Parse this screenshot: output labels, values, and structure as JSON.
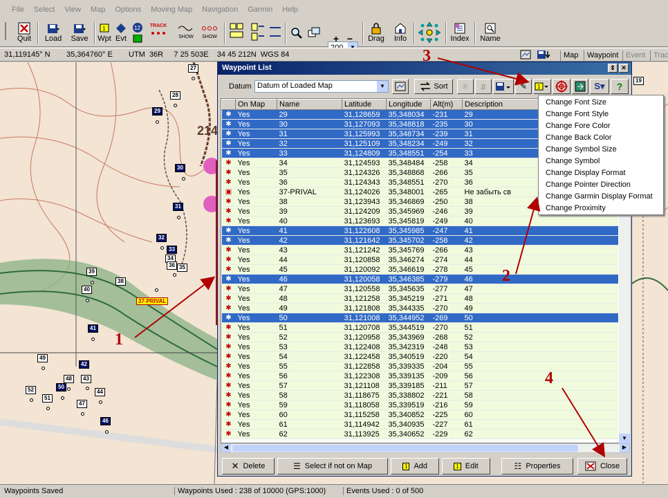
{
  "menubar": {
    "items": [
      "File",
      "Select",
      "View",
      "Map",
      "Options",
      "Moving Map",
      "Navigation",
      "Garmin",
      "Help"
    ]
  },
  "toolbar": {
    "quit": "Quit",
    "load": "Load",
    "save": "Save",
    "wpt": "Wpt",
    "evt": "Evt",
    "zoom_value": "200",
    "drag": "Drag",
    "info": "Info",
    "index": "Index",
    "name": "Name",
    "show1": "SHOW",
    "show2": "SHOW",
    "track": "TRACK"
  },
  "coords": {
    "lat": "31,119145° N",
    "lon": "35,364760° E",
    "utm": "UTM  36R     7 25 503E    34 45 212N  WGS 84",
    "tabs": [
      "Map",
      "Waypoint",
      "Event",
      "Trac"
    ]
  },
  "window": {
    "title": "Waypoint List",
    "datum_label": "Datum",
    "datum_value": "Datum of Loaded Map",
    "sort": "Sort"
  },
  "columns": [
    "On Map",
    "Name",
    "Latitude",
    "Longitude",
    "Alt(m)",
    "Description"
  ],
  "rows": [
    {
      "onmap": "Yes",
      "name": "29",
      "lat": "31,128659",
      "lon": "35,348034",
      "alt": "-231",
      "desc": "29",
      "sel": true
    },
    {
      "onmap": "Yes",
      "name": "30",
      "lat": "31,127093",
      "lon": "35,348818",
      "alt": "-235",
      "desc": "30",
      "sel": true
    },
    {
      "onmap": "Yes",
      "name": "31",
      "lat": "31,125993",
      "lon": "35,348734",
      "alt": "-239",
      "desc": "31",
      "sel": true
    },
    {
      "onmap": "Yes",
      "name": "32",
      "lat": "31,125109",
      "lon": "35,348234",
      "alt": "-249",
      "desc": "32",
      "sel": true
    },
    {
      "onmap": "Yes",
      "name": "33",
      "lat": "31,124809",
      "lon": "35,348551",
      "alt": "-254",
      "desc": "33",
      "sel": true
    },
    {
      "onmap": "Yes",
      "name": "34",
      "lat": "31,124593",
      "lon": "35,348484",
      "alt": "-258",
      "desc": "34",
      "sel": false
    },
    {
      "onmap": "Yes",
      "name": "35",
      "lat": "31,124326",
      "lon": "35,348868",
      "alt": "-266",
      "desc": "35",
      "sel": false
    },
    {
      "onmap": "Yes",
      "name": "36",
      "lat": "31,124343",
      "lon": "35,348551",
      "alt": "-270",
      "desc": "36",
      "sel": false
    },
    {
      "onmap": "Yes",
      "name": "37-PRIVAL",
      "lat": "31,124026",
      "lon": "35,348001",
      "alt": "-265",
      "desc": "Не забыть св",
      "sel": false
    },
    {
      "onmap": "Yes",
      "name": "38",
      "lat": "31,123943",
      "lon": "35,346869",
      "alt": "-250",
      "desc": "38",
      "sel": false
    },
    {
      "onmap": "Yes",
      "name": "39",
      "lat": "31,124209",
      "lon": "35,345969",
      "alt": "-246",
      "desc": "39",
      "sel": false
    },
    {
      "onmap": "Yes",
      "name": "40",
      "lat": "31,123693",
      "lon": "35,345819",
      "alt": "-249",
      "desc": "40",
      "sel": false
    },
    {
      "onmap": "Yes",
      "name": "41",
      "lat": "31,122608",
      "lon": "35,345985",
      "alt": "-247",
      "desc": "41",
      "sel": true
    },
    {
      "onmap": "Yes",
      "name": "42",
      "lat": "31,121642",
      "lon": "35,345702",
      "alt": "-258",
      "desc": "42",
      "sel": true
    },
    {
      "onmap": "Yes",
      "name": "43",
      "lat": "31,121242",
      "lon": "35,345769",
      "alt": "-266",
      "desc": "43",
      "sel": false
    },
    {
      "onmap": "Yes",
      "name": "44",
      "lat": "31,120858",
      "lon": "35,346274",
      "alt": "-274",
      "desc": "44",
      "sel": false
    },
    {
      "onmap": "Yes",
      "name": "45",
      "lat": "31,120092",
      "lon": "35,346619",
      "alt": "-278",
      "desc": "45",
      "sel": false
    },
    {
      "onmap": "Yes",
      "name": "46",
      "lat": "31,120058",
      "lon": "35,346385",
      "alt": "-279",
      "desc": "46",
      "sel": true
    },
    {
      "onmap": "Yes",
      "name": "47",
      "lat": "31,120558",
      "lon": "35,345635",
      "alt": "-277",
      "desc": "47",
      "sel": false
    },
    {
      "onmap": "Yes",
      "name": "48",
      "lat": "31,121258",
      "lon": "35,345219",
      "alt": "-271",
      "desc": "48",
      "sel": false
    },
    {
      "onmap": "Yes",
      "name": "49",
      "lat": "31,121808",
      "lon": "35,344335",
      "alt": "-270",
      "desc": "49",
      "sel": false
    },
    {
      "onmap": "Yes",
      "name": "50",
      "lat": "31,121008",
      "lon": "35,344952",
      "alt": "-269",
      "desc": "50",
      "sel": true
    },
    {
      "onmap": "Yes",
      "name": "51",
      "lat": "31,120708",
      "lon": "35,344519",
      "alt": "-270",
      "desc": "51",
      "sel": false
    },
    {
      "onmap": "Yes",
      "name": "52",
      "lat": "31,120958",
      "lon": "35,343969",
      "alt": "-268",
      "desc": "52",
      "sel": false
    },
    {
      "onmap": "Yes",
      "name": "53",
      "lat": "31,122408",
      "lon": "35,342319",
      "alt": "-248",
      "desc": "53",
      "sel": false
    },
    {
      "onmap": "Yes",
      "name": "54",
      "lat": "31,122458",
      "lon": "35,340519",
      "alt": "-220",
      "desc": "54",
      "sel": false
    },
    {
      "onmap": "Yes",
      "name": "55",
      "lat": "31,122858",
      "lon": "35,339335",
      "alt": "-204",
      "desc": "55",
      "sel": false
    },
    {
      "onmap": "Yes",
      "name": "56",
      "lat": "31,122308",
      "lon": "35,339135",
      "alt": "-209",
      "desc": "56",
      "sel": false
    },
    {
      "onmap": "Yes",
      "name": "57",
      "lat": "31,121108",
      "lon": "35,339185",
      "alt": "-211",
      "desc": "57",
      "sel": false
    },
    {
      "onmap": "Yes",
      "name": "58",
      "lat": "31,118675",
      "lon": "35,338802",
      "alt": "-221",
      "desc": "58",
      "sel": false
    },
    {
      "onmap": "Yes",
      "name": "59",
      "lat": "31,118058",
      "lon": "35,339519",
      "alt": "-216",
      "desc": "59",
      "sel": false
    },
    {
      "onmap": "Yes",
      "name": "60",
      "lat": "31,115258",
      "lon": "35,340852",
      "alt": "-225",
      "desc": "60",
      "sel": false
    },
    {
      "onmap": "Yes",
      "name": "61",
      "lat": "31,114942",
      "lon": "35,340935",
      "alt": "-227",
      "desc": "61",
      "sel": false
    },
    {
      "onmap": "Yes",
      "name": "62",
      "lat": "31,113925",
      "lon": "35,340652",
      "alt": "-229",
      "desc": "62",
      "sel": false
    }
  ],
  "context_menu": [
    "Change Font Size",
    "Change Font Style",
    "Change Fore Color",
    "Change Back Color",
    "Change Symbol Size",
    "Change Symbol",
    "Change Display Format",
    "Change Pointer Direction",
    "Change Garmin Display Format",
    "Change Proximity"
  ],
  "bottom_buttons": {
    "delete": "Delete",
    "select_not_on_map": "Select if not on Map",
    "add": "Add",
    "edit": "Edit",
    "properties": "Properties",
    "close": "Close"
  },
  "annotations": [
    "1",
    "2",
    "3",
    "4"
  ],
  "map_labels": [
    "27",
    "28",
    "29",
    "30",
    "31",
    "32",
    "33",
    "34",
    "35",
    "36",
    "38",
    "39",
    "40",
    "41",
    "42",
    "43",
    "44",
    "46",
    "47",
    "48",
    "49",
    "50",
    "51",
    "52",
    "19"
  ],
  "map_prival": "37-PRIVAL",
  "status": {
    "left": "Waypoints Saved",
    "mid": "Waypoints Used : 238 of 10000  (GPS:1000)",
    "right": "Events Used : 0 of 500"
  },
  "colors": {
    "selection": "#316ac5",
    "row_bg": "#f0fadd",
    "title_bar": "#0a246a",
    "annotation": "#b00000"
  }
}
